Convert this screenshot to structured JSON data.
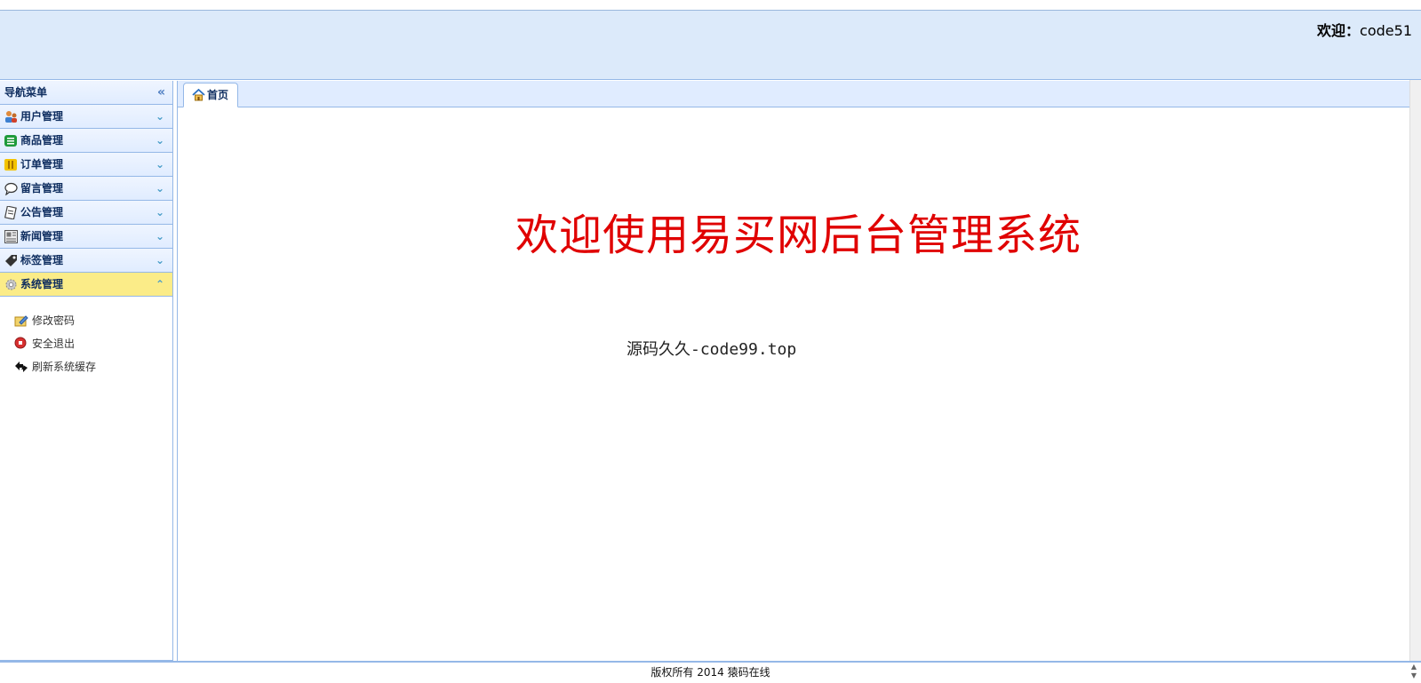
{
  "header": {
    "welcome_label": "欢迎：",
    "username": "code51"
  },
  "sidebar": {
    "title": "导航菜单",
    "collapse_icon": "«",
    "sections": [
      {
        "label": "用户管理",
        "icon": "users-icon",
        "expanded": false
      },
      {
        "label": "商品管理",
        "icon": "list-icon",
        "expanded": false
      },
      {
        "label": "订单管理",
        "icon": "order-icon",
        "expanded": false
      },
      {
        "label": "留言管理",
        "icon": "comment-icon",
        "expanded": false
      },
      {
        "label": "公告管理",
        "icon": "notice-icon",
        "expanded": false
      },
      {
        "label": "新闻管理",
        "icon": "news-icon",
        "expanded": false
      },
      {
        "label": "标签管理",
        "icon": "tag-icon",
        "expanded": false
      },
      {
        "label": "系统管理",
        "icon": "gear-icon",
        "expanded": true
      }
    ],
    "system_items": [
      {
        "label": "修改密码",
        "icon": "edit-password-icon"
      },
      {
        "label": "安全退出",
        "icon": "logout-icon"
      },
      {
        "label": "刷新系统缓存",
        "icon": "refresh-icon"
      }
    ]
  },
  "tabs": [
    {
      "label": "首页",
      "icon": "home-icon",
      "active": true
    }
  ],
  "content": {
    "title": "欢迎使用易买网后台管理系统",
    "subtitle": "源码久久-code99.top"
  },
  "footer": {
    "copyright": "版权所有 2014 猿码在线"
  },
  "colors": {
    "header_bg": "#dceafa",
    "border": "#95b8e7",
    "active_section": "#fbec88",
    "title_red": "#e00000"
  }
}
